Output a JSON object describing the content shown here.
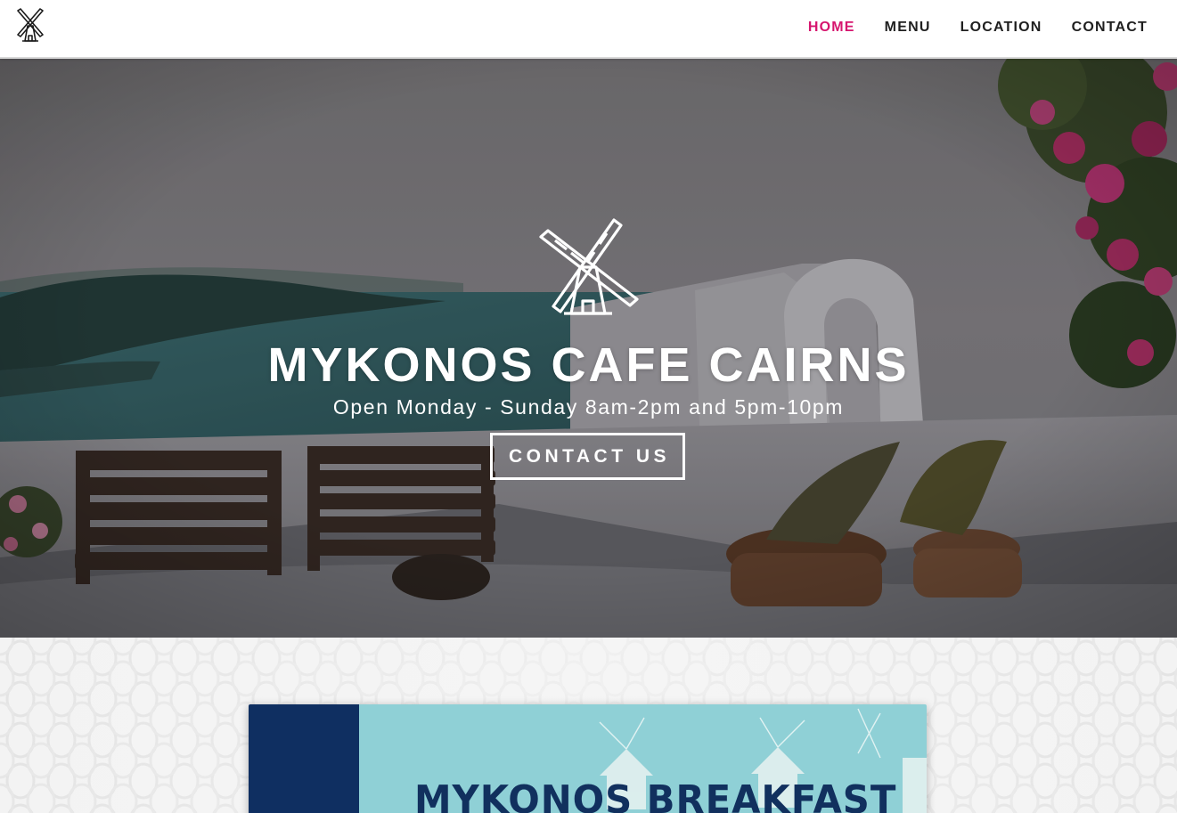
{
  "nav": {
    "logo_icon": "windmill-icon",
    "items": [
      {
        "label": "HOME",
        "active": true
      },
      {
        "label": "MENU",
        "active": false
      },
      {
        "label": "LOCATION",
        "active": false
      },
      {
        "label": "CONTACT",
        "active": false
      }
    ],
    "active_color": "#d6156e"
  },
  "hero": {
    "logo_icon": "windmill-icon",
    "title": "MYKONOS CAFE CAIRNS",
    "subtitle": "Open Monday - Sunday 8am-2pm and 5pm-10pm",
    "cta_label": "CONTACT US"
  },
  "menu_card": {
    "title": "MYKONOS BREAKFAST",
    "colors": {
      "navy": "#0f2f61",
      "sky": "#8fd0d6"
    }
  }
}
